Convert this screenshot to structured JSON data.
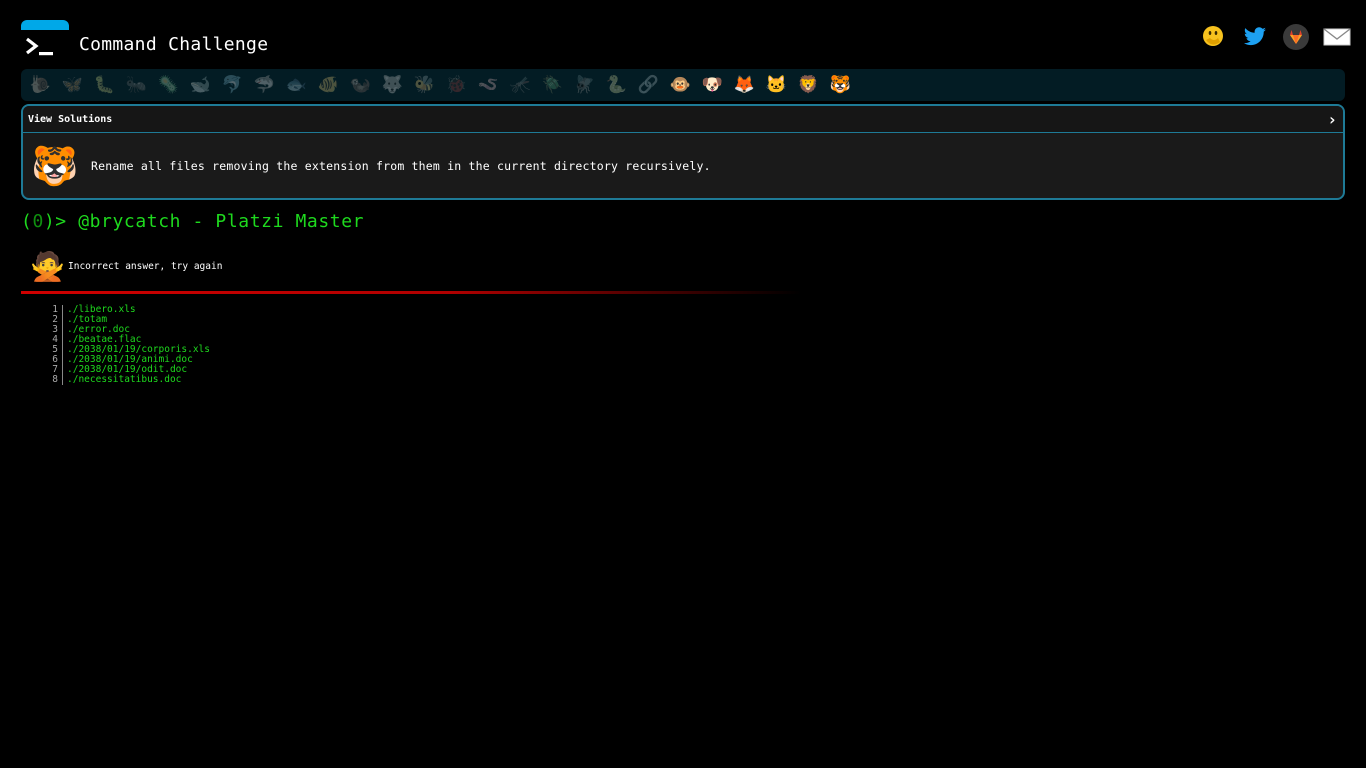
{
  "header": {
    "title": "Command Challenge",
    "social": [
      {
        "icon": "face-hand-over-mouth-icon",
        "glyph": "🤭"
      },
      {
        "icon": "twitter-icon",
        "glyph": "🐦"
      },
      {
        "icon": "gitlab-icon",
        "glyph": "🦊"
      },
      {
        "icon": "envelope-icon",
        "glyph": "✉"
      }
    ]
  },
  "animals": [
    {
      "name": "snail",
      "glyph": "🐌",
      "dim": true
    },
    {
      "name": "butterfly",
      "glyph": "🦋",
      "dim": true
    },
    {
      "name": "caterpillar",
      "glyph": "🐛",
      "dim": true
    },
    {
      "name": "ant",
      "glyph": "🐜",
      "dim": true
    },
    {
      "name": "virus",
      "glyph": "🦠",
      "dim": true
    },
    {
      "name": "whale",
      "glyph": "🐋",
      "dim": true
    },
    {
      "name": "dolphin",
      "glyph": "🐬",
      "dim": true
    },
    {
      "name": "shark",
      "glyph": "🦈",
      "dim": true
    },
    {
      "name": "fish",
      "glyph": "🐟",
      "dim": true
    },
    {
      "name": "tropical-fish",
      "glyph": "🐠",
      "dim": true
    },
    {
      "name": "otter",
      "glyph": "🦦",
      "dim": true
    },
    {
      "name": "wolf",
      "glyph": "🐺",
      "dim": true
    },
    {
      "name": "bee",
      "glyph": "🐝",
      "dim": true
    },
    {
      "name": "ladybug",
      "glyph": "🐞",
      "dim": true
    },
    {
      "name": "worm",
      "glyph": "🪱",
      "dim": true
    },
    {
      "name": "mosquito",
      "glyph": "🦟",
      "dim": true
    },
    {
      "name": "beetle",
      "glyph": "🪲",
      "dim": true
    },
    {
      "name": "fly",
      "glyph": "🪰",
      "dim": true
    },
    {
      "name": "snake",
      "glyph": "🐍",
      "dim": true
    },
    {
      "name": "chain",
      "glyph": "🔗",
      "dim": true
    },
    {
      "name": "monkey",
      "glyph": "🐵",
      "dim": false
    },
    {
      "name": "dog",
      "glyph": "🐶",
      "dim": false
    },
    {
      "name": "fox",
      "glyph": "🦊",
      "dim": false
    },
    {
      "name": "cat",
      "glyph": "🐱",
      "dim": false
    },
    {
      "name": "lion",
      "glyph": "🦁",
      "dim": false
    },
    {
      "name": "tiger",
      "glyph": "🐯",
      "dim": false
    }
  ],
  "challenge": {
    "toggle_label": "View Solutions",
    "chevron": "›",
    "animal_glyph": "🐯",
    "description": "Rename all files removing the extension from them in the current directory recursively."
  },
  "prompt": {
    "open": "(",
    "count": "0",
    "close": ")> ",
    "user": "@brycatch - Platzi Master"
  },
  "result": {
    "emoji": "🙅",
    "message": "Incorrect answer, try again"
  },
  "output": [
    {
      "n": "1",
      "text": "./libero.xls"
    },
    {
      "n": "2",
      "text": "./totam"
    },
    {
      "n": "3",
      "text": "./error.doc"
    },
    {
      "n": "4",
      "text": "./beatae.flac"
    },
    {
      "n": "5",
      "text": "./2038/01/19/corporis.xls"
    },
    {
      "n": "6",
      "text": "./2038/01/19/animi.doc"
    },
    {
      "n": "7",
      "text": "./2038/01/19/odit.doc"
    },
    {
      "n": "8",
      "text": "./necessitatibus.doc"
    }
  ],
  "colors": {
    "accent": "#00a8e8",
    "border": "#1e7a96",
    "prompt_green": "#1ed91e",
    "error_red": "#d00000"
  }
}
